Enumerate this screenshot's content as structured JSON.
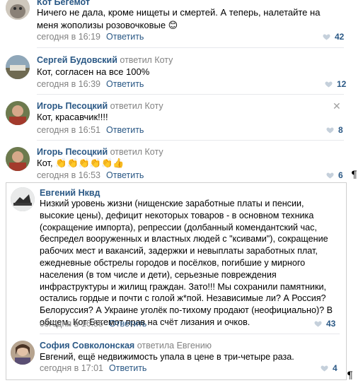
{
  "comments": [
    {
      "author": "Кот Бегемот",
      "reply_to": "",
      "text": "Ничего не дала, кроме нищеты и смертей. А теперь, налетайте на меня жополизы розовочковые 😊",
      "time": "сегодня в 16:19",
      "reply_label": "Ответить",
      "likes": "42"
    },
    {
      "author": "Сергей Будовский",
      "reply_to": "ответил Коту",
      "text": "Кот, согласен на все 100%",
      "time": "сегодня в 16:39",
      "reply_label": "Ответить",
      "likes": "12"
    },
    {
      "author": "Игорь Песоцкий",
      "reply_to": "ответил Коту",
      "text": "Кот, красавчик!!!!",
      "time": "сегодня в 16:51",
      "reply_label": "Ответить",
      "likes": "8"
    },
    {
      "author": "Игорь Песоцкий",
      "reply_to": "ответил Коту",
      "text": "Кот, ",
      "emoji": "👏👏👏👏👏👍",
      "time": "сегодня в 16:53",
      "reply_label": "Ответить",
      "likes": "6"
    },
    {
      "author": "Евгений Нквд",
      "reply_to": "",
      "text": "Низкий уровень жизни (нищенские заработные платы и пенсии, высокие цены), дефицит некоторых товаров - в основном техника (сокращение импорта), репрессии (долбанный комендантский час, беспредел вооруженных и властных людей с \"ксивами\"), сокращение рабочих мест и вакансий, задержки и невыплаты заработных плат, ежедневные обстрелы городов и посёлков, погибшие у мирного населения (в том числе и дети), серьезные повреждения инфраструктуры и жилищ граждан. Зато!!! Мы сохранили памятники, остались гордые и почти с голой ж*пой. Независимые ли? А Россия? Белоруссия? А Украине уголёк по-тихому продают (неофициально)? В общем, Кот Бегемот прав на счёт лизания и очков.",
      "time": "сегодня в 16:55",
      "reply_label": "Ответить",
      "likes": "43"
    },
    {
      "author": "София Совколонская",
      "reply_to": "ответила Евгению",
      "text": "Евгений, ещё недвижимость упала в цене в три-четыре раза.",
      "time": "сегодня в 17:01",
      "reply_label": "Ответить",
      "likes": "4"
    }
  ],
  "close_glyph": "✕",
  "pilcrow": "¶",
  "colors": {
    "link": "#2a5885",
    "meta": "#828282",
    "heart": "#c5d0db"
  }
}
